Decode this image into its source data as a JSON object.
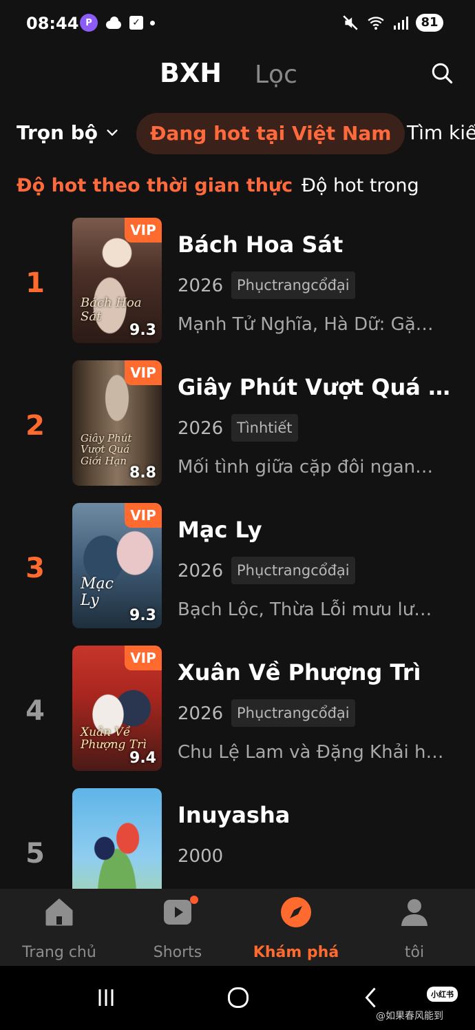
{
  "status_bar": {
    "time": "08:44",
    "battery": "81",
    "app_badge": "P",
    "check_glyph": "✓"
  },
  "header": {
    "tabs": [
      {
        "label": "BXH",
        "active": true
      },
      {
        "label": "Lọc",
        "active": false
      }
    ],
    "search_icon": "search-icon"
  },
  "filters": {
    "scope": "Trọn bộ",
    "active_chip": "Đang hot tại Việt Nam",
    "next_chip": "Tìm kiế"
  },
  "sub_tabs": {
    "active": "Độ hot theo thời gian thực",
    "other": "Độ hot trong"
  },
  "colors": {
    "accent": "#ff6a2e",
    "background": "#121212",
    "nav_background": "#1f1f1f"
  },
  "ranking": [
    {
      "rank": "1",
      "title": "Bách Hoa Sát",
      "year": "2026",
      "tag": "Phụctrangcổđại",
      "description": "Mạnh Tử Nghĩa, Hà Dữ: Gặ…",
      "score": "9.3",
      "vip": "VIP",
      "poster_text": "Bách Hoa Sát"
    },
    {
      "rank": "2",
      "title": "Giây Phút Vượt Quá …",
      "year": "2026",
      "tag": "Tìnhtiết",
      "description": "Mối tình giữa cặp đôi ngan…",
      "score": "8.8",
      "vip": "VIP",
      "poster_text": "Giây Phút Vượt Quá Giới Hạn"
    },
    {
      "rank": "3",
      "title": "Mạc Ly",
      "year": "2026",
      "tag": "Phụctrangcổđại",
      "description": "Bạch Lộc, Thừa Lỗi mưu lư…",
      "score": "9.3",
      "vip": "VIP",
      "poster_text": "Mạc Ly"
    },
    {
      "rank": "4",
      "title": "Xuân Về Phượng Trì",
      "year": "2026",
      "tag": "Phụctrangcổđại",
      "description": "Chu Lệ Lam và Đặng Khải h…",
      "score": "9.4",
      "vip": "VIP",
      "poster_text": "Xuân Về Phượng Trì"
    },
    {
      "rank": "5",
      "title": "Inuyasha",
      "year": "2000",
      "tag": "",
      "description": "",
      "score": "",
      "vip": "",
      "poster_text": ""
    }
  ],
  "bottom_nav": [
    {
      "label": "Trang chủ",
      "icon": "home-icon",
      "active": false
    },
    {
      "label": "Shorts",
      "icon": "play-icon",
      "active": false
    },
    {
      "label": "Khám phá",
      "icon": "compass-icon",
      "active": true
    },
    {
      "label": "tôi",
      "icon": "user-icon",
      "active": false
    }
  ],
  "system_nav": {
    "badge": "小红书",
    "watermark": "@如果春风能到"
  }
}
